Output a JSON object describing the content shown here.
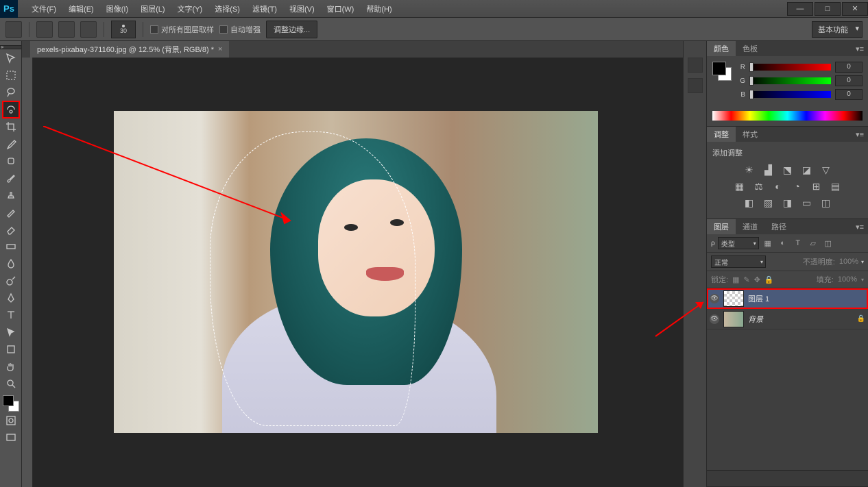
{
  "app": {
    "logo": "Ps"
  },
  "menu": [
    "文件(F)",
    "编辑(E)",
    "图像(I)",
    "图层(L)",
    "文字(Y)",
    "选择(S)",
    "滤镜(T)",
    "视图(V)",
    "窗口(W)",
    "帮助(H)"
  ],
  "window_controls": {
    "min": "—",
    "max": "□",
    "close": "✕"
  },
  "options": {
    "brush_size": "30",
    "sample_all": "对所有图层取样",
    "auto_enhance": "自动增强",
    "refine_edge": "调整边缘...",
    "workspace": "基本功能"
  },
  "doc_tab": "pexels-pixabay-371160.jpg @ 12.5% (背景, RGB/8) *",
  "color_panel": {
    "tabs": [
      "颜色",
      "色板"
    ],
    "channels": [
      {
        "l": "R",
        "v": "0"
      },
      {
        "l": "G",
        "v": "0"
      },
      {
        "l": "B",
        "v": "0"
      }
    ]
  },
  "adjust_panel": {
    "tabs": [
      "调整",
      "样式"
    ],
    "title": "添加调整"
  },
  "layers_panel": {
    "tabs": [
      "图层",
      "通道",
      "路径"
    ],
    "kind": "类型",
    "blend": "正常",
    "opacity_label": "不透明度:",
    "opacity_val": "100%",
    "lock_label": "锁定:",
    "fill_label": "填充:",
    "fill_val": "100%",
    "layers": [
      {
        "name": "图层 1",
        "trans": true,
        "sel": true,
        "locked": false
      },
      {
        "name": "背景",
        "trans": false,
        "sel": false,
        "locked": true
      }
    ]
  }
}
